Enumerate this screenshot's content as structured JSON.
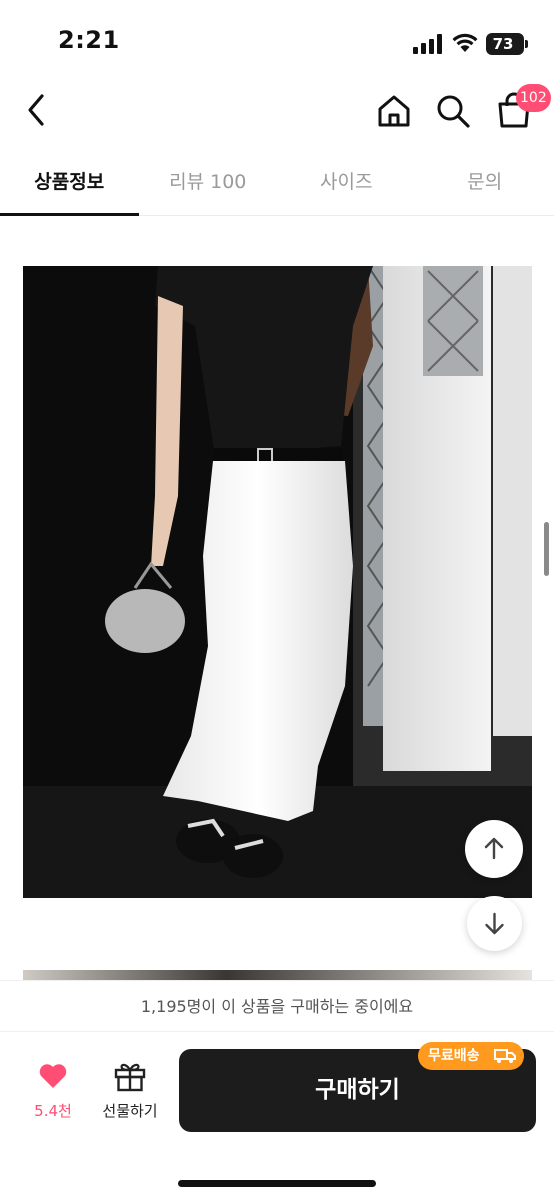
{
  "status_bar": {
    "time": "2:21",
    "battery": "73"
  },
  "header": {
    "icons": [
      "back-icon",
      "home-icon",
      "search-icon",
      "cart-icon"
    ],
    "cart_count": "102"
  },
  "tabs": [
    {
      "label": "상품정보",
      "active": true
    },
    {
      "label": "리뷰 100",
      "active": false
    },
    {
      "label": "사이즈",
      "active": false
    },
    {
      "label": "문의",
      "active": false
    }
  ],
  "product_image": {
    "subject": "product-photo"
  },
  "buyers_banner": "1,195명이 이 상품을 구매하는 중이에요",
  "actions": {
    "like_count": "5.4천",
    "gift_label": "선물하기",
    "buy_label": "구매하기",
    "free_shipping_badge": "무료배송"
  },
  "colors": {
    "accent": "#ff4d73",
    "buy_button": "#1c1c1c",
    "badge": "#ff9a1f"
  }
}
